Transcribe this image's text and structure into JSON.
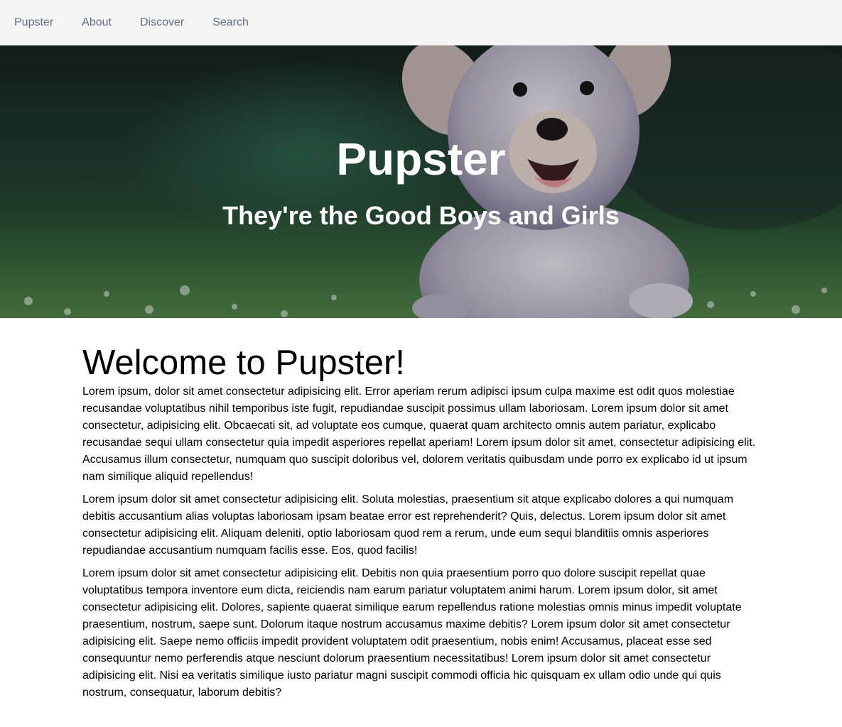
{
  "nav": {
    "items": [
      {
        "label": "Pupster"
      },
      {
        "label": "About"
      },
      {
        "label": "Discover"
      },
      {
        "label": "Search"
      }
    ]
  },
  "hero": {
    "title": "Pupster",
    "subtitle": "They're the Good Boys and Girls",
    "image": "running-puppy-photo"
  },
  "main": {
    "heading": "Welcome to Pupster!",
    "paragraphs": [
      "Lorem ipsum, dolor sit amet consectetur adipisicing elit. Error aperiam rerum adipisci ipsum culpa maxime est odit quos molestiae recusandae voluptatibus nihil temporibus iste fugit, repudiandae suscipit possimus ullam laboriosam. Lorem ipsum dolor sit amet consectetur, adipisicing elit. Obcaecati sit, ad voluptate eos cumque, quaerat quam architecto omnis autem pariatur, explicabo recusandae sequi ullam consectetur quia impedit asperiores repellat aperiam! Lorem ipsum dolor sit amet, consectetur adipisicing elit. Accusamus illum consectetur, numquam quo suscipit doloribus vel, dolorem veritatis quibusdam unde porro ex explicabo id ut ipsum nam similique aliquid repellendus!",
      "Lorem ipsum dolor sit amet consectetur adipisicing elit. Soluta molestias, praesentium sit atque explicabo dolores a qui numquam debitis accusantium alias voluptas laboriosam ipsam beatae error est reprehenderit? Quis, delectus. Lorem ipsum dolor sit amet consectetur adipisicing elit. Aliquam deleniti, optio laboriosam quod rem a rerum, unde eum sequi blanditiis omnis asperiores repudiandae accusantium numquam facilis esse. Eos, quod facilis!",
      "Lorem ipsum dolor sit amet consectetur adipisicing elit. Debitis non quia praesentium porro quo dolore suscipit repellat quae voluptatibus tempora inventore eum dicta, reiciendis nam earum pariatur voluptatem animi harum. Lorem ipsum dolor, sit amet consectetur adipisicing elit. Dolores, sapiente quaerat similique earum repellendus ratione molestias omnis minus impedit voluptate praesentium, nostrum, saepe sunt. Dolorum itaque nostrum accusamus maxime debitis? Lorem ipsum dolor sit amet consectetur adipisicing elit. Saepe nemo officiis impedit provident voluptatem odit praesentium, nobis enim! Accusamus, placeat esse sed consequuntur nemo perferendis atque nesciunt dolorum praesentium necessitatibus! Lorem ipsum dolor sit amet consectetur adipisicing elit. Nisi ea veritatis similique iusto pariatur magni suscipit commodi officia hic quisquam ex ullam odio unde qui quis nostrum, consequatur, laborum debitis?"
    ]
  },
  "colors": {
    "nav_background": "#f5f5f5",
    "nav_link": "#5f6d8a",
    "hero_text": "#ffffff",
    "body_text": "#000000"
  }
}
